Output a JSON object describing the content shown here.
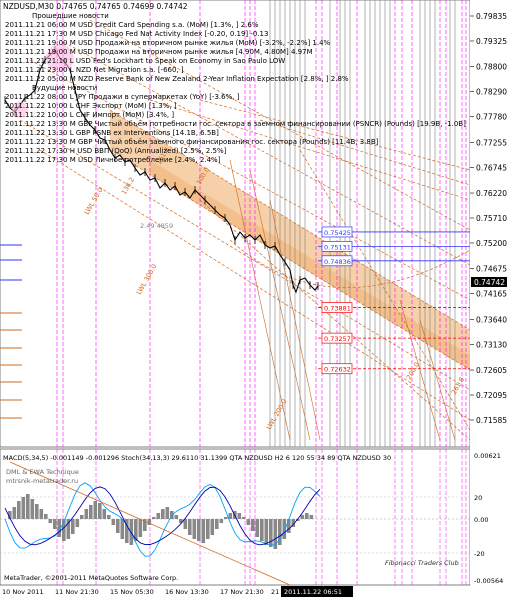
{
  "header": {
    "symbol_line": "NZDUSD,M30  0.74765 0.74765 0.74699 0.74742"
  },
  "news": {
    "past_title": "Прошедшие новости",
    "future_title": "Будущие новости",
    "past_items": [
      "2011.11.21 06:00 M USD Credit Card Spending s.a. (MoM) [1.3%, ] 2.6%",
      "2011.11.21 17:30 M USD Chicago Fed Nat Activity Index [-0.20, 0.19] -0.13",
      "2011.11.21 19:00 M USD Продажи на вторичном рынке жилья (MoM) [-3.2%, -2.2%] 1.4%",
      "2011.11.21 19:00 M USD Продажи на вторичном рынке жилья [4.90M, 4.80M] 4.97M",
      "2011.11.21 21:10 L USD Fed's Lockhart to Speak on Economy in Sao Paulo LOW",
      "2011.11.21 23:00 L NZD Net Migration s.a. [-660, ]",
      "2011.11.22 05:00 M NZD Reserve Bank of New Zealand 2-Year Inflation Expectation [2.8%, ] 2.8%"
    ],
    "future_items": [
      "2011.11.22 08:00 L JPY Продажи в супермаркетах (YoY) [-3.6%, ]",
      "2011.11.22 10:00 L CHF Экспорт (MoM) [1.3%, ]",
      "2011.11.22 10:00 L CHF Импорт (MoM) [3.4%, ]",
      "2011.11.22 13:30 M GBP Чистый объём потребности гос. сектора в заемном финансировании (PSNCR) (Pounds) [19.9B, -1.0B]",
      "2011.11.22 13:30 L GBP PSNB ex Interventions [14.1B, 6.5B]",
      "2011.11.22 13:30 M GBP Чистый объём заемного финансирования гос. сектора (Pounds) [11.4B, 3.8B]",
      "2011.11.22 17:30 H USD ВВП (QoQ) (Annualized) [2.5%, 2.5%]",
      "2011.11.22 17:30 M USD Личное потребление [2.4%, 2.4%]"
    ]
  },
  "price_axis": {
    "labels": [
      "0.79835",
      "0.79325",
      "0.78800",
      "0.78290",
      "0.77780",
      "0.77255",
      "0.76745",
      "0.76220",
      "0.75710",
      "0.75200",
      "0.74675",
      "0.74165",
      "0.73640",
      "0.73130",
      "0.72605",
      "0.72095",
      "0.71585"
    ],
    "current_price": "0.74742"
  },
  "level_labels": [
    {
      "text": "0.75425",
      "kind": "resistance",
      "value": 0.75425
    },
    {
      "text": "0.75131",
      "kind": "resistance",
      "value": 0.75131
    },
    {
      "text": "0.74836",
      "kind": "resistance",
      "value": 0.74836
    },
    {
      "text": "0.73881",
      "kind": "support",
      "value": 0.73881
    },
    {
      "text": "0.73257",
      "kind": "support",
      "value": 0.73257
    },
    {
      "text": "0.72632",
      "kind": "support",
      "value": 0.72632
    }
  ],
  "fib_labels": [
    "LWL 50.0",
    "LWL 300.0",
    "LWL 200.0",
    "100.0",
    "138.2",
    "161.8",
    "200.0",
    "261.8"
  ],
  "channel_label": "2.49 4859",
  "indicator": {
    "header_text": "MACD(5,34,5) -0.001149 -0.001296  Stoch(34,13,3) 29.6110 31.1399  QTA NZDUSD H2  6  120  55  34  89  QTA NZDUSD 30",
    "left_labels": [
      "DML & EWA Technique",
      "mtrsnik-metatrader.ru"
    ],
    "axis_labels": [
      "0.00621",
      "20",
      "0.00",
      "-20",
      "-0.00564"
    ],
    "copyright": "MetaTrader, ©2001-2011 MetaQuotes Software Corp.",
    "watermark": "Fibonacci Traders Club"
  },
  "time_axis": {
    "labels": [
      "10 Nov 2011",
      "11 Nov 21:30",
      "15 Nov 05:30",
      "16 Nov 13:30",
      "17 Nov 21:30",
      "21"
    ],
    "highlight": "2011.11.22 06:51"
  },
  "colors": {
    "channel_fill": "#f5c89a",
    "channel_line": "#d2691e",
    "resistance": "#3333ff",
    "support": "#ff0000",
    "news_past_line": "#ff00ff",
    "news_future_line": "#808080",
    "macd_hist": "#888888",
    "stoch_main": "#00a2ff",
    "stoch_signal": "#0000aa"
  }
}
